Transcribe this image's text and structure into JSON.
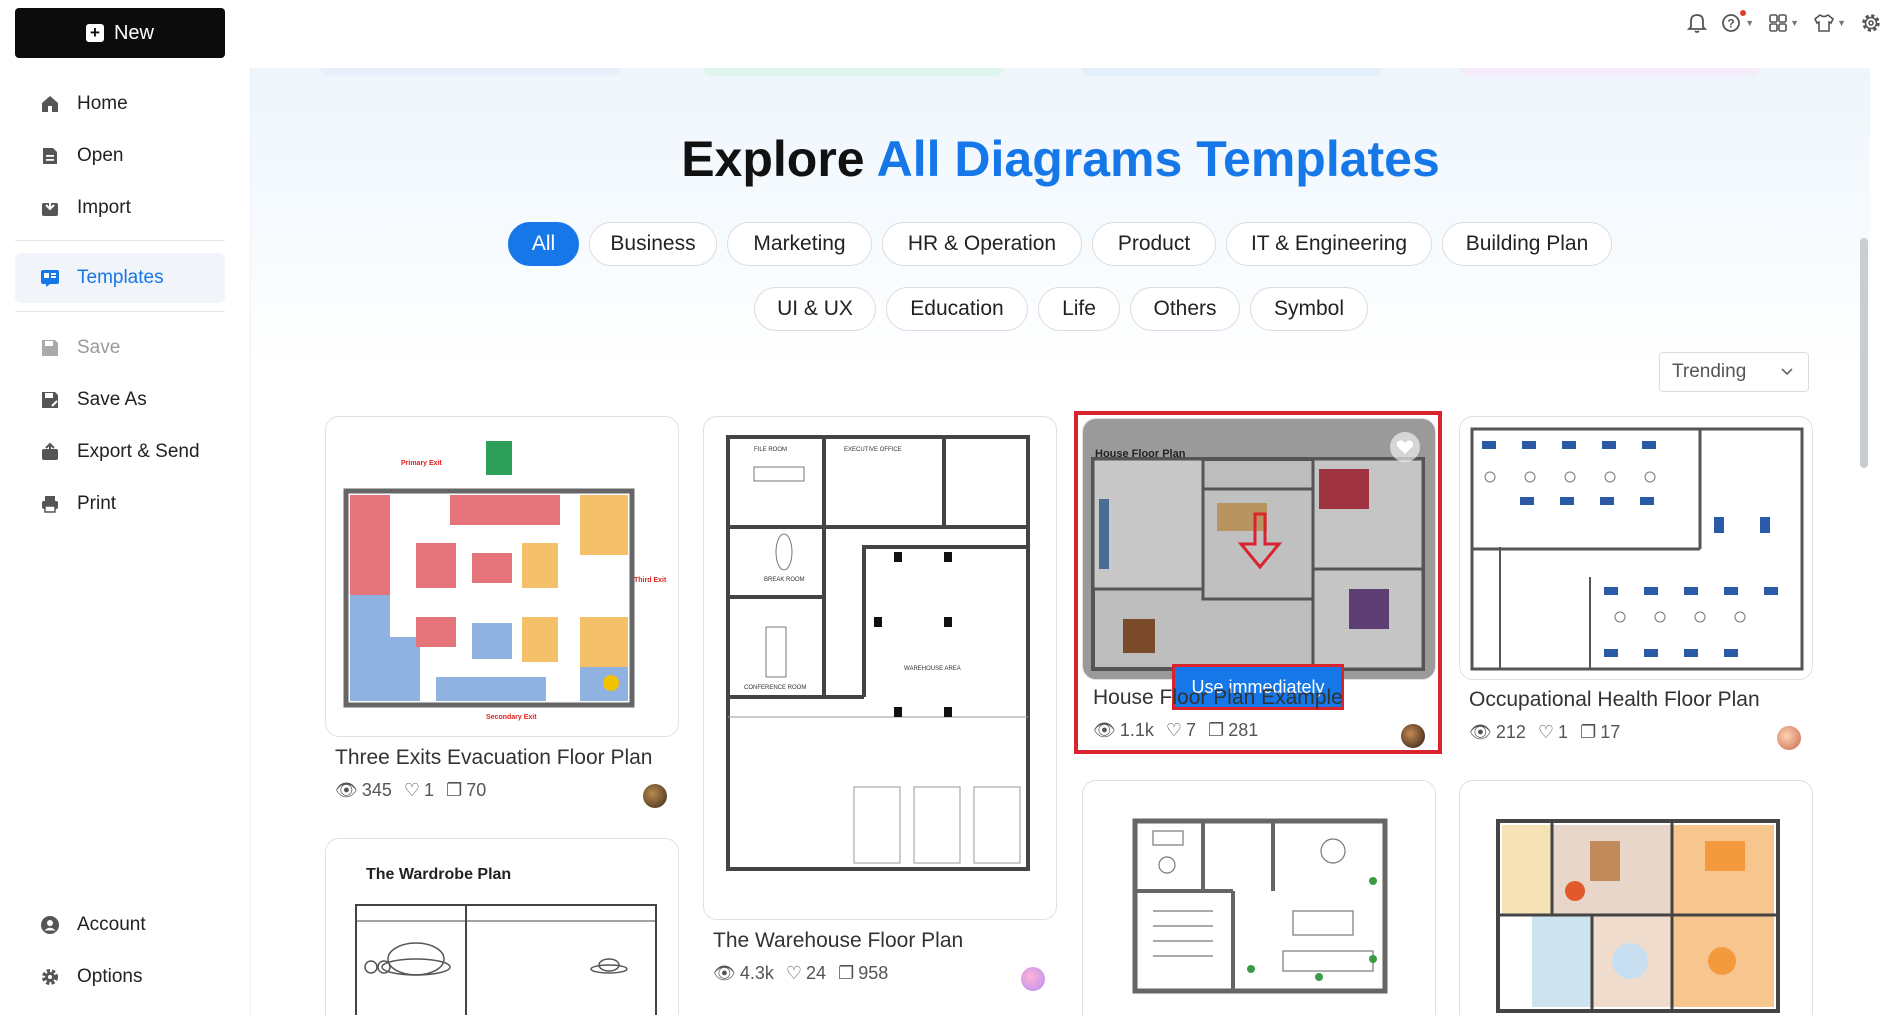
{
  "sidebar": {
    "new_label": "New",
    "items": [
      {
        "label": "Home",
        "icon": "home-icon"
      },
      {
        "label": "Open",
        "icon": "file-icon"
      },
      {
        "label": "Import",
        "icon": "import-icon"
      },
      {
        "label": "Templates",
        "icon": "templates-icon",
        "active": true
      },
      {
        "label": "Save",
        "icon": "save-icon",
        "disabled": true
      },
      {
        "label": "Save As",
        "icon": "save-as-icon"
      },
      {
        "label": "Export & Send",
        "icon": "export-icon"
      },
      {
        "label": "Print",
        "icon": "print-icon"
      },
      {
        "label": "Account",
        "icon": "account-icon"
      },
      {
        "label": "Options",
        "icon": "gear-icon"
      }
    ]
  },
  "topbar": {
    "icons": [
      "bell-icon",
      "help-icon",
      "apps-icon",
      "shirt-icon",
      "settings-icon"
    ]
  },
  "hero": {
    "title_plain": "Explore",
    "title_accent": "All Diagrams Templates"
  },
  "filters": [
    {
      "label": "All",
      "active": true
    },
    {
      "label": "Business"
    },
    {
      "label": "Marketing"
    },
    {
      "label": "HR & Operation"
    },
    {
      "label": "Product"
    },
    {
      "label": "IT & Engineering"
    },
    {
      "label": "Building Plan"
    },
    {
      "label": "UI & UX"
    },
    {
      "label": "Education"
    },
    {
      "label": "Life"
    },
    {
      "label": "Others"
    },
    {
      "label": "Symbol"
    }
  ],
  "sort": {
    "value": "Trending"
  },
  "cards": [
    {
      "title": "Three Exits Evacuation Floor Plan",
      "views": "345",
      "likes": "1",
      "copies": "70",
      "labels": {
        "primary_exit": "Primary Exit",
        "third_exit": "Third Exit",
        "secondary_exit": "Secondary Exit"
      }
    },
    {
      "title": "The Warehouse Floor Plan",
      "views": "4.3k",
      "likes": "24",
      "copies": "958",
      "labels": {
        "file_room": "FILE ROOM",
        "exec_office": "EXECUTIVE OFFICE",
        "break_room": "BREAK ROOM",
        "conference_room": "CONFERENCE ROOM",
        "warehouse_area": "WAREHOUSE AREA"
      }
    },
    {
      "title": "House Floor Plan Example",
      "views": "1.1k",
      "likes": "7",
      "copies": "281",
      "use_label": "Use immediately",
      "thumb_title": "House Floor Plan"
    },
    {
      "title": "Occupational Health Floor Plan",
      "views": "212",
      "likes": "1",
      "copies": "17"
    },
    {
      "thumb_title": "The Wardrobe Plan"
    },
    {},
    {}
  ],
  "colors": {
    "accent": "#1677e8",
    "highlight": "#d9232d"
  }
}
